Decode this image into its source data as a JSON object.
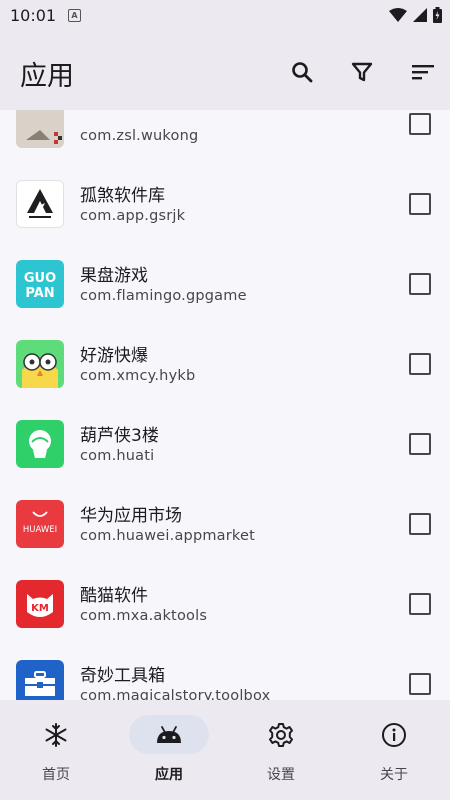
{
  "status": {
    "time": "10:01",
    "notification_letter": "A"
  },
  "appbar": {
    "title": "应用"
  },
  "icons": {
    "search": "search-icon",
    "filter": "filter-icon",
    "sort": "sort-icon"
  },
  "apps": [
    {
      "name": "",
      "package": "com.zsl.wukong",
      "icon": "wukong-app-icon",
      "checked": false
    },
    {
      "name": "孤煞软件库",
      "package": "com.app.gsrjk",
      "icon": "gsrjk-app-icon",
      "checked": false
    },
    {
      "name": "果盘游戏",
      "package": "com.flamingo.gpgame",
      "icon": "guopan-app-icon",
      "checked": false
    },
    {
      "name": "好游快爆",
      "package": "com.xmcy.hykb",
      "icon": "hykb-app-icon",
      "checked": false
    },
    {
      "name": "葫芦侠3楼",
      "package": "com.huati",
      "icon": "huluxia-app-icon",
      "checked": false
    },
    {
      "name": "华为应用市场",
      "package": "com.huawei.appmarket",
      "icon": "huawei-appmarket-icon",
      "icon_text": "HUAWEI",
      "checked": false
    },
    {
      "name": "酷猫软件",
      "package": "com.mxa.aktools",
      "icon": "kumao-app-icon",
      "icon_text": "KM",
      "checked": false
    },
    {
      "name": "奇妙工具箱",
      "package": "com.magicalstory.toolbox",
      "icon": "toolbox-app-icon",
      "checked": false
    }
  ],
  "bottom_nav": [
    {
      "label": "首页",
      "icon": "snowflake-icon",
      "active": false
    },
    {
      "label": "应用",
      "icon": "android-icon",
      "active": true
    },
    {
      "label": "设置",
      "icon": "gear-icon",
      "active": false
    },
    {
      "label": "关于",
      "icon": "info-icon",
      "active": false
    }
  ]
}
